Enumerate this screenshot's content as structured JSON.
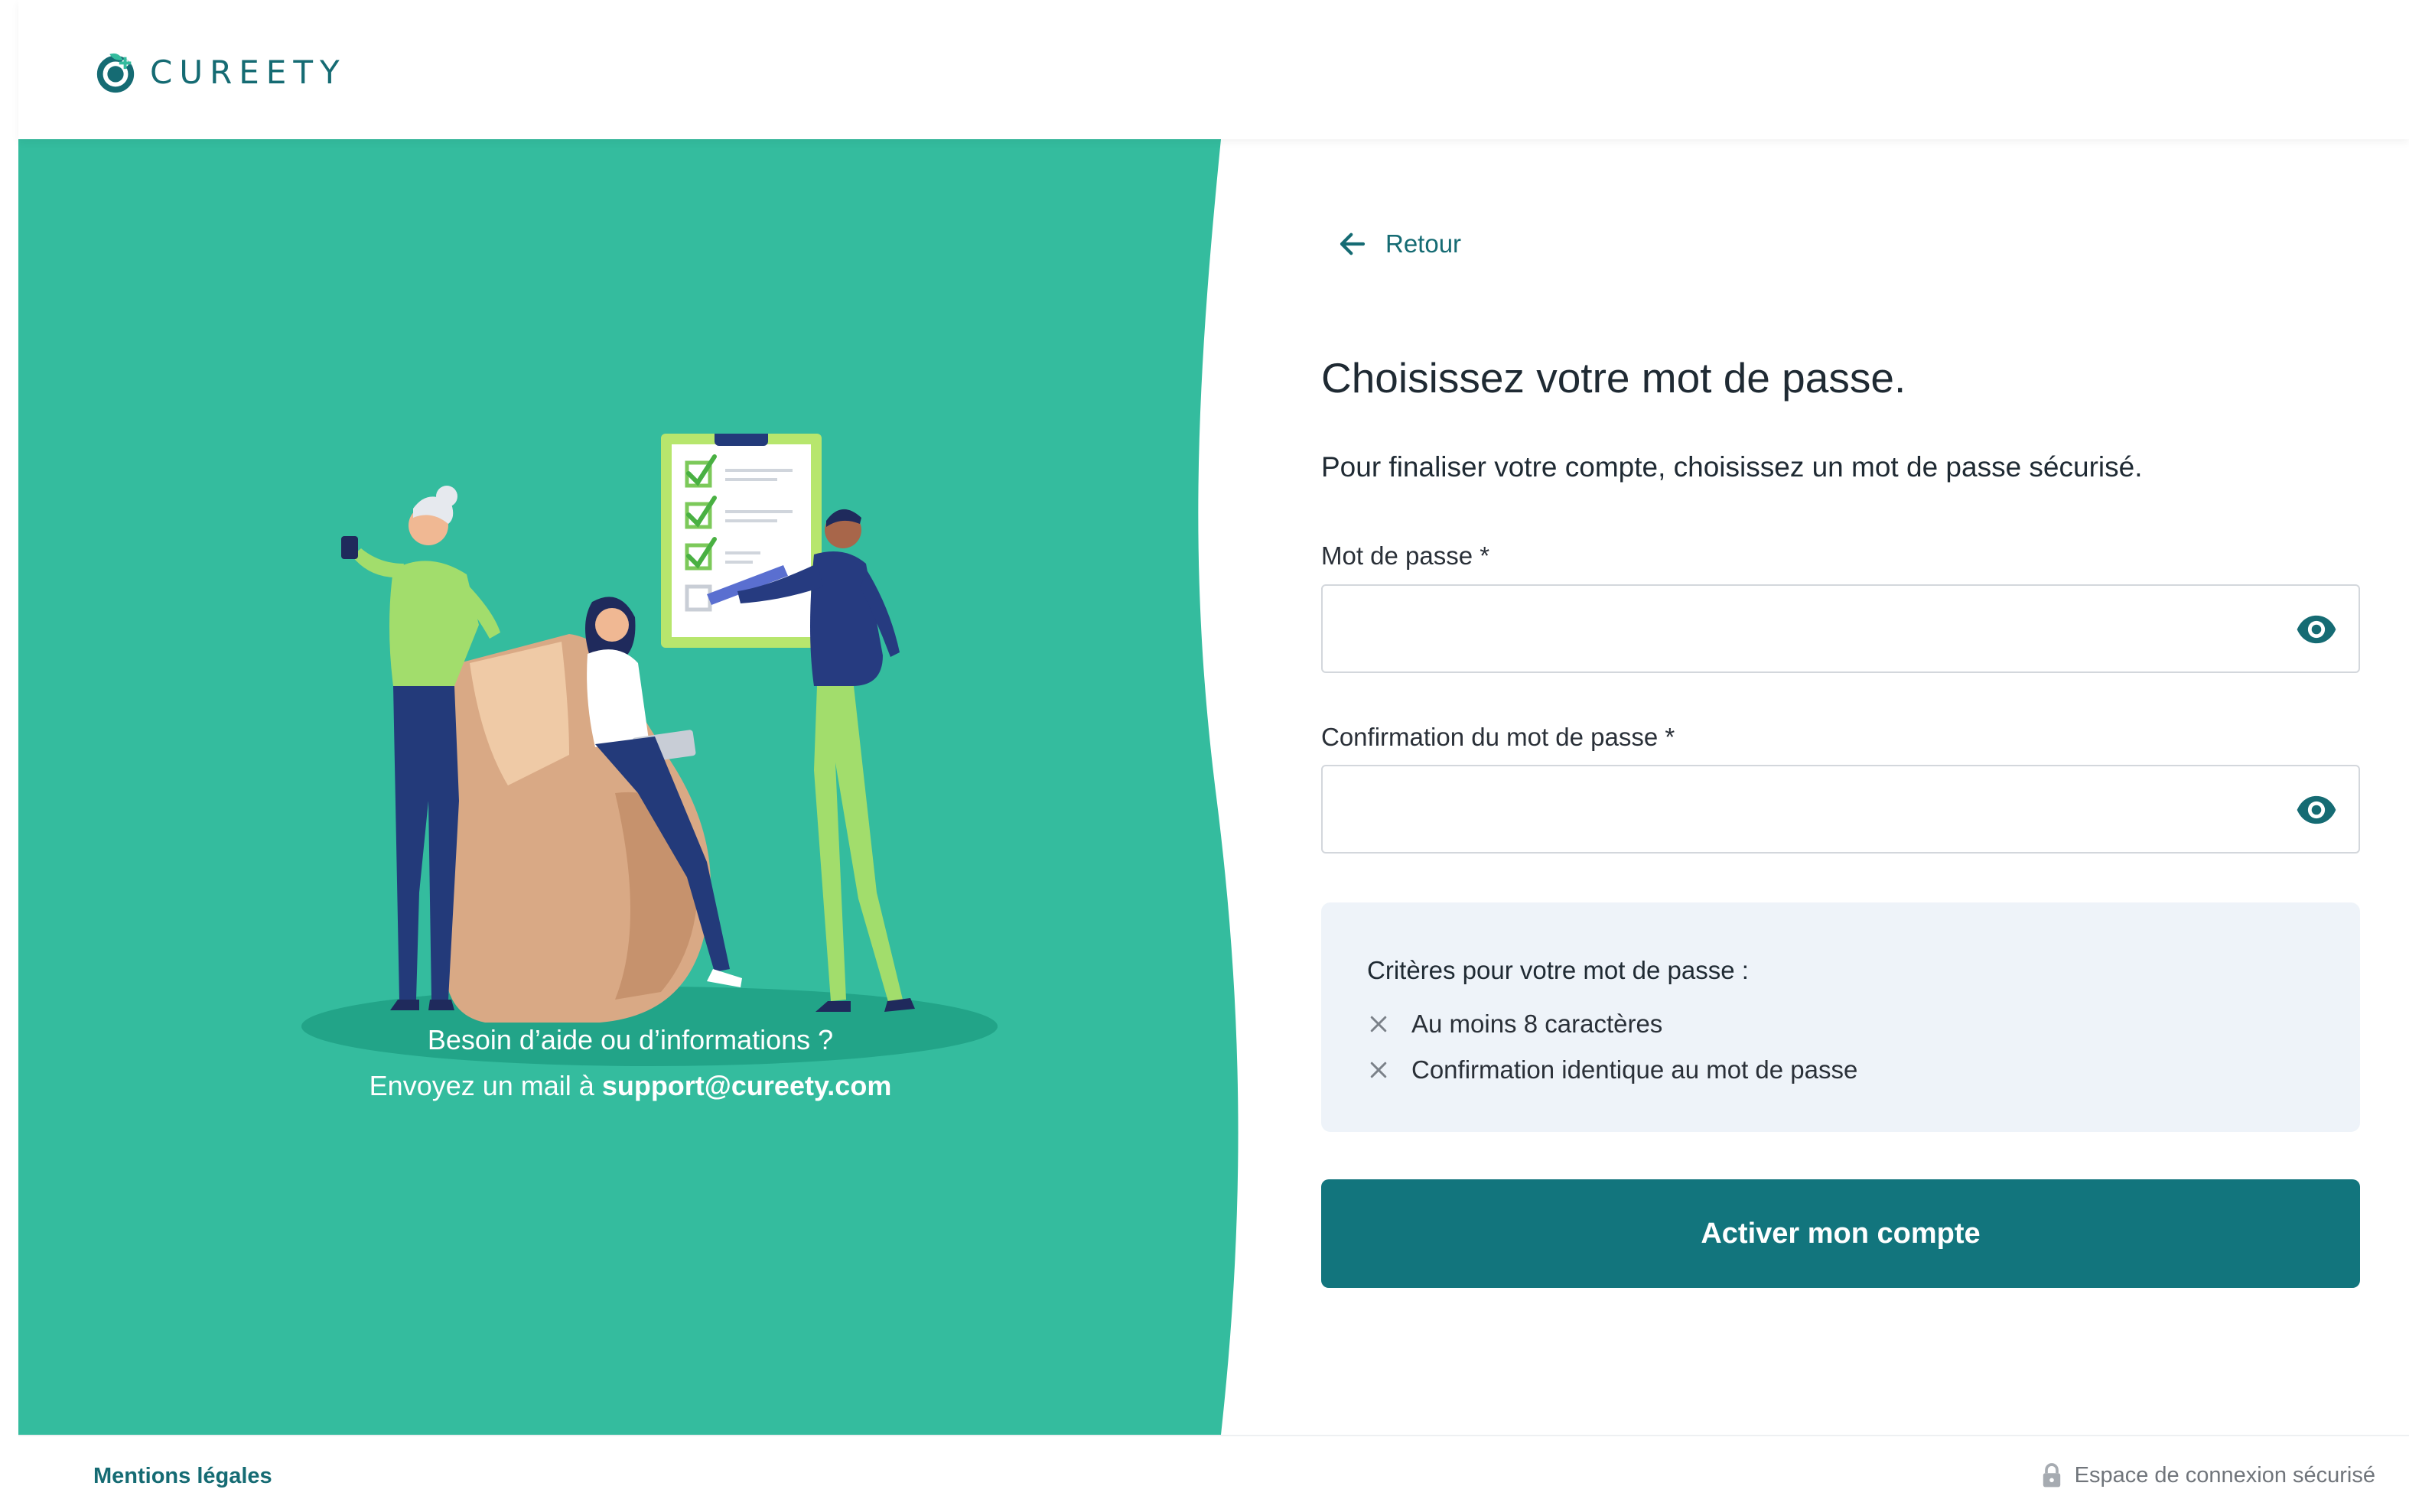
{
  "brand": {
    "name": "CUREETY",
    "logo_icon": "cureety-logo-icon",
    "primary_color": "#156b73",
    "accent_color": "#34bc9e"
  },
  "hero": {
    "illustration": "patients-checklist-illustration",
    "help_line1": "Besoin d’aide ou d’informations ?",
    "help_line2_prefix": "Envoyez un mail à ",
    "support_email": "support@cureety.com"
  },
  "form": {
    "back_label": "Retour",
    "back_icon": "arrow-left-icon",
    "title": "Choisissez votre mot de passe.",
    "subtitle": "Pour finaliser votre compte, choisissez un mot de passe sécurisé.",
    "password": {
      "label": "Mot de passe *",
      "value": "",
      "placeholder": "",
      "toggle_icon": "eye-icon"
    },
    "confirm": {
      "label": "Confirmation du mot de passe *",
      "value": "",
      "placeholder": "",
      "toggle_icon": "eye-icon"
    },
    "criteria": {
      "title": "Critères pour votre mot de passe :",
      "items": [
        {
          "label": "Au moins 8 caractères",
          "status_icon": "x-icon"
        },
        {
          "label": "Confirmation identique au mot de passe",
          "status_icon": "x-icon"
        }
      ]
    },
    "submit_label": "Activer mon compte",
    "button_color": "#12757d"
  },
  "footer": {
    "legal_label": "Mentions légales",
    "secure_label": "Espace de connexion sécurisé",
    "secure_icon": "lock-icon"
  }
}
